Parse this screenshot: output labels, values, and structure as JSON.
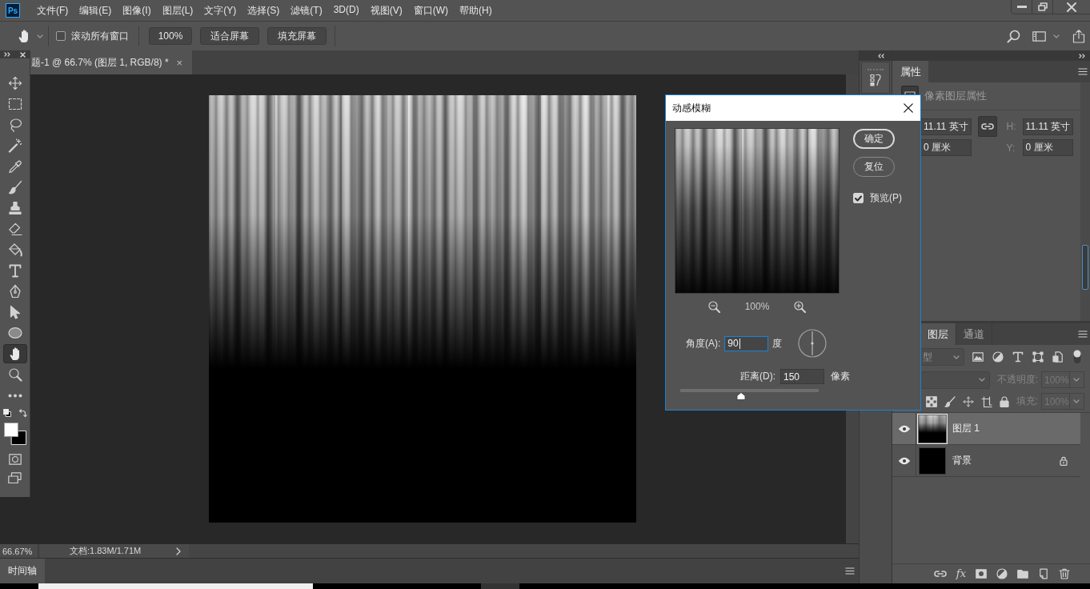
{
  "app": {
    "logo": "Ps"
  },
  "menu": [
    "文件(F)",
    "编辑(E)",
    "图像(I)",
    "图层(L)",
    "文字(Y)",
    "选择(S)",
    "滤镜(T)",
    "3D(D)",
    "视图(V)",
    "窗口(W)",
    "帮助(H)"
  ],
  "options_bar": {
    "scroll_all_windows": {
      "label": "滚动所有窗口",
      "checked": false
    },
    "buttons": [
      "100%",
      "适合屏幕",
      "填充屏幕"
    ]
  },
  "tools": [
    {
      "selected": false
    },
    {
      "selected": false
    },
    {
      "selected": false
    },
    {
      "selected": false
    },
    {
      "selected": false
    },
    {
      "selected": false
    },
    {
      "selected": false
    },
    {
      "selected": false
    },
    {
      "selected": false
    },
    {
      "selected": false
    },
    {
      "selected": false
    },
    {
      "selected": false
    },
    {
      "selected": false
    },
    {
      "selected": true
    },
    {
      "selected": false
    },
    {
      "selected": false
    }
  ],
  "document_tab": {
    "title": "题-1 @ 66.7% (图层 1, RGB/8) *",
    "close": "×"
  },
  "status_bar": {
    "zoom": "66.67%",
    "doc_info": "文档:1.83M/1.71M"
  },
  "timeline": {
    "tabs": [
      {
        "label": "时间轴",
        "selected": true
      }
    ]
  },
  "properties": {
    "tabs": [
      {
        "label": "属性",
        "selected": true
      }
    ],
    "layer_type": "像素图层属性",
    "width": "11.11 英寸",
    "h_label": "H:",
    "height": "11.11 英寸",
    "x": "0 厘米",
    "y_label": "Y:",
    "y": "0 厘米"
  },
  "layers_panel": {
    "tabs": [
      {
        "label": "图层",
        "selected": true
      },
      {
        "label": "通道",
        "selected": false
      }
    ],
    "filter": "型",
    "opacity": {
      "label": "不透明度:",
      "value": "100%",
      "disabled": true
    },
    "fill": {
      "label": "填充:",
      "value": "100%",
      "disabled": true
    },
    "layers": [
      {
        "name": "图层 1",
        "kind": "streaks",
        "selected": true,
        "visible": true,
        "locked": false
      },
      {
        "name": "背景",
        "kind": "solid",
        "selected": false,
        "visible": true,
        "locked": true
      }
    ],
    "footer": {
      "effects": "fx"
    }
  },
  "dialog": {
    "title": "动感模糊",
    "buttons": [
      {
        "label": "确定",
        "default": true
      },
      {
        "label": "复位",
        "default": false
      }
    ],
    "preview": {
      "label": "预览(P)",
      "checked": true
    },
    "zoom": "100%",
    "angle": {
      "label": "角度(A):",
      "value": "90",
      "unit": "度",
      "focused": true
    },
    "distance": {
      "label": "距离(D):",
      "value": "150",
      "unit": "像素",
      "focused": false,
      "level": 0.44
    }
  }
}
